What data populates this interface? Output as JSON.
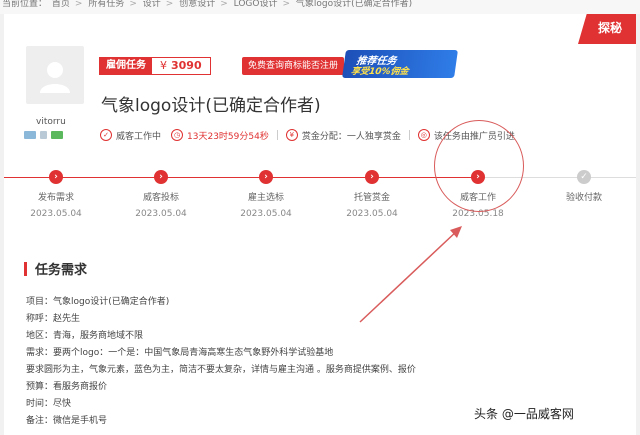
{
  "breadcrumb": [
    "当前位置：",
    "首页",
    "所有任务",
    "设计",
    "创意设计",
    "LOGO设计",
    "气象logo设计(已确定合作者)"
  ],
  "user": {
    "name": "vitorru"
  },
  "task": {
    "mode_label": "雇佣任务",
    "price_symbol": "¥",
    "price": "3090",
    "query_button": "免费查询商标能否注册",
    "title": "气象logo设计(已确定合作者)",
    "status_label": "威客工作中",
    "countdown": "13天23时59分54秒",
    "reward_label": "赏金分配：",
    "reward_value": "一人独享赏金",
    "promo_text": "该任务由推广员引进"
  },
  "promo_banner": {
    "line1": "推荐任务",
    "line2": "享受10%佣金"
  },
  "corner_tag": "探秘",
  "steps": [
    {
      "label": "发布需求",
      "date": "2023.05.04",
      "state": "done"
    },
    {
      "label": "威客投标",
      "date": "2023.05.04",
      "state": "done"
    },
    {
      "label": "雇主选标",
      "date": "2023.05.04",
      "state": "done"
    },
    {
      "label": "托管赏金",
      "date": "2023.05.04",
      "state": "done"
    },
    {
      "label": "威客工作",
      "date": "2023.05.18",
      "state": "current"
    },
    {
      "label": "验收付款",
      "date": "",
      "state": "pending"
    }
  ],
  "section": {
    "title": "任务需求",
    "lines": [
      "项目：气象logo设计(已确定合作者)",
      "称呼：赵先生",
      "地区：青海，服务商地域不限",
      "需求：要两个logo：一个是：中国气象局青海高寒生态气象野外科学试验基地",
      "要求圆形为主，气象元素，蓝色为主，简洁不要太复杂，详情与雇主沟通 。服务商提供案例、报价",
      "预算：看服务商报价",
      "时间：尽快",
      "备注：微信是手机号"
    ]
  },
  "watermark": "头条 @一品威客网",
  "colors": {
    "accent": "#e03232",
    "promo_blue": "#2f7de8"
  }
}
